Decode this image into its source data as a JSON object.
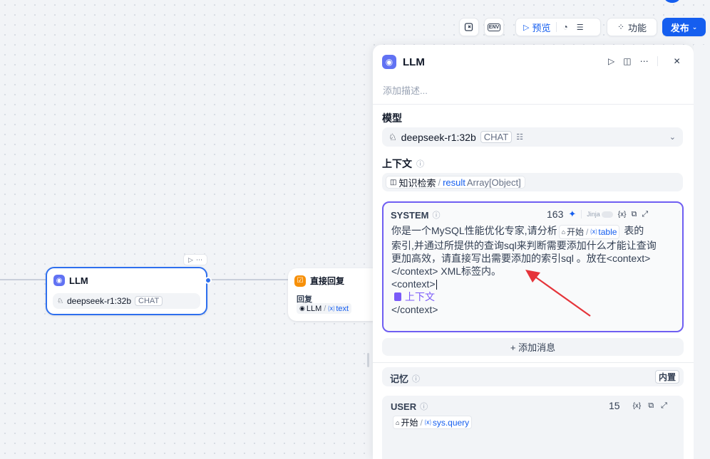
{
  "toolbar": {
    "preview_label": "预览",
    "features_label": "功能",
    "publish_label": "发布",
    "env_label": "ENV"
  },
  "canvas": {
    "llm_node": {
      "title": "LLM",
      "model": "deepseek-r1:32b",
      "mode": "CHAT"
    },
    "reply_node": {
      "title": "直接回复",
      "field_label": "回复",
      "source_node": "LLM",
      "source_var": "text"
    }
  },
  "panel": {
    "title": "LLM",
    "description_placeholder": "添加描述...",
    "model_section": {
      "label": "模型",
      "model_name": "deepseek-r1:32b",
      "mode": "CHAT"
    },
    "context_section": {
      "label": "上下文",
      "source_node": "知识检索",
      "var_name": "result",
      "var_type": "Array[Object]"
    },
    "system_prompt": {
      "label": "SYSTEM",
      "token_count": "163",
      "jinja_label": "Jinja",
      "var_label": "{x}",
      "text_part1": "你是一个MySQL性能优化专家,请分析",
      "ref_node": "开始",
      "ref_var": "table",
      "text_part2": "表的",
      "text_line2": "索引,并通过所提供的查询sql来判断需要添加什么才能让查询",
      "text_line3": "更加高效，请直接写出需要添加的索引sql 。放在<context>",
      "text_line4": "</context> XML标签内。",
      "text_line5": "<context>",
      "context_chip": "上下文",
      "text_line6": "</context>"
    },
    "add_message_label": "+ 添加消息",
    "memory_section": {
      "label": "记忆",
      "badge": "内置"
    },
    "user_prompt": {
      "label": "USER",
      "token_count": "15",
      "var_label": "{x}",
      "ref_node": "开始",
      "ref_var": "sys.query"
    }
  },
  "colors": {
    "accent": "#155eef",
    "publish_bg": "#155eef",
    "llm_icon": "#6172f3",
    "reply_icon": "#f79009",
    "annotation_arrow": "#e5343a"
  }
}
